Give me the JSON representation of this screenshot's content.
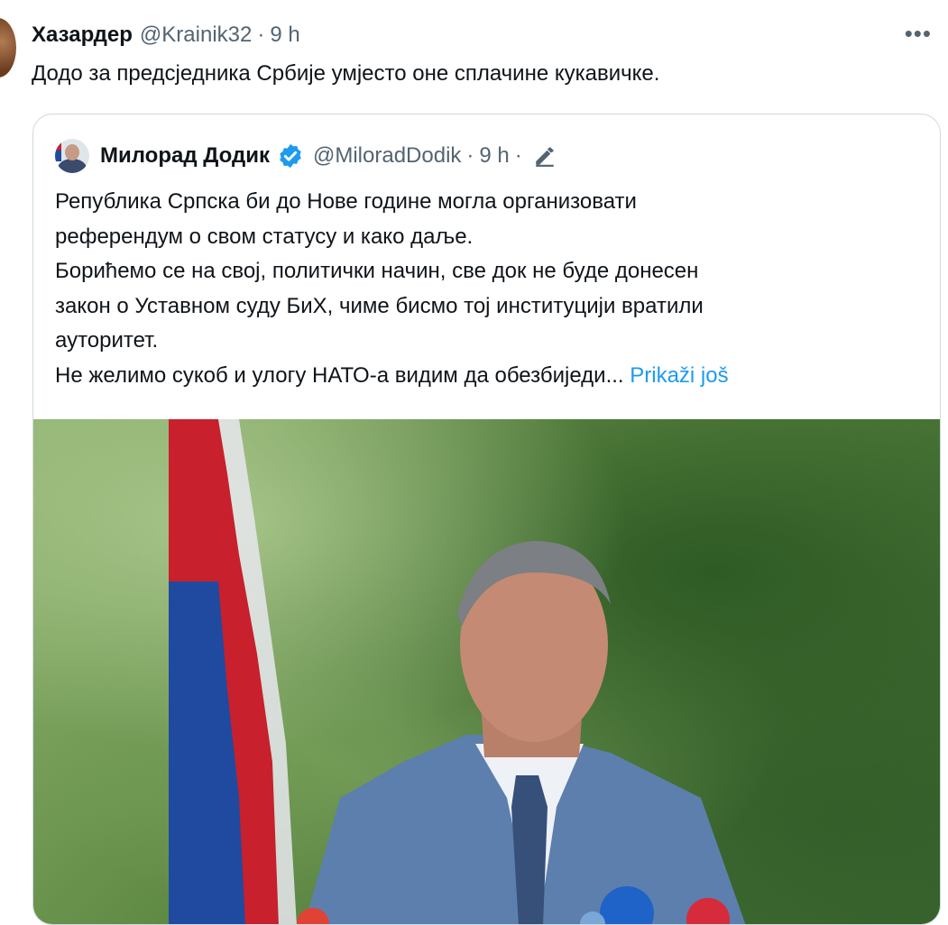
{
  "tweet": {
    "author_name": "Хазардер",
    "handle": "@Krainik32",
    "time": "9 h",
    "separator": "·",
    "text": "Додо за предсједника Србије умјесто оне сплачине кукавичке.",
    "more_icon": "ellipsis-icon"
  },
  "quoted_tweet": {
    "author_name": "Милорад Додик",
    "handle": "@MiloradDodik",
    "separator": "·",
    "time": "9 h",
    "separator2": "·",
    "verified_icon": "verified-badge-icon",
    "edited_icon": "pencil-icon",
    "lines": [
      "Република Српска би до Нове године могла организовати",
      "референдум о свом статусу и како даље.",
      "Борићемо се на свој, политички начин, све док не буде донесен",
      "закон о Уставном суду БиХ, чиме бисмо тој институцији вратили",
      "ауторитет.",
      "Не желимо сукоб и улогу НАТО-а видим да обезбиједи..."
    ],
    "show_more": "Prikaži još"
  },
  "colors": {
    "accent": "#1d9bf0",
    "muted": "#536471",
    "text": "#0f1419",
    "border": "#cfd9de",
    "flag_red": "#c8202c",
    "flag_blue": "#1f4aa0"
  }
}
